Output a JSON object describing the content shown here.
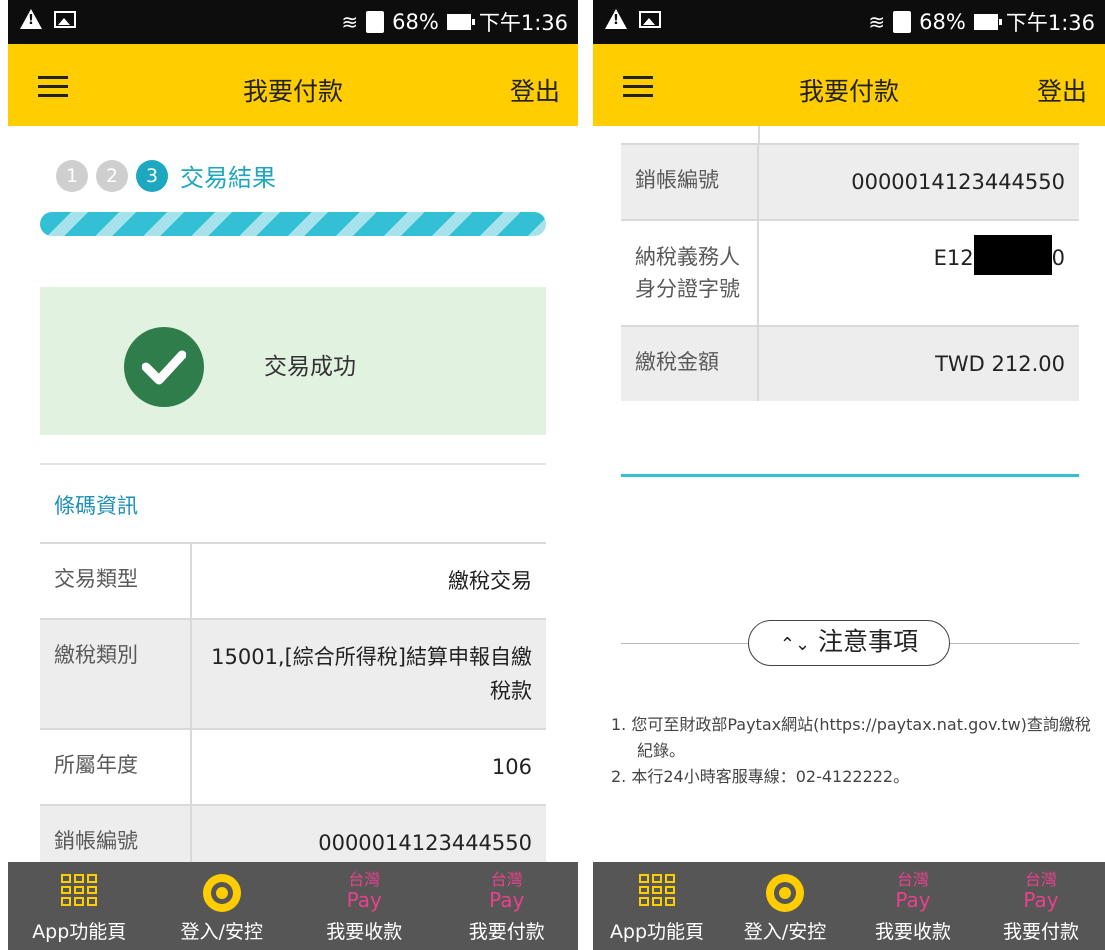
{
  "status_bar": {
    "battery": "68%",
    "time": "下午1:36"
  },
  "header": {
    "title": "我要付款",
    "logout": "登出"
  },
  "steps": {
    "items": [
      "1",
      "2",
      "3"
    ],
    "current_label": "交易結果"
  },
  "result": {
    "message": "交易成功"
  },
  "section": {
    "title": "條碼資訊"
  },
  "left_rows": [
    {
      "key": "交易類型",
      "value": "繳稅交易"
    },
    {
      "key": "繳稅類別",
      "value": "15001,[綜合所得稅]結算申報自繳稅款"
    },
    {
      "key": "所屬年度",
      "value": "106"
    },
    {
      "key": "銷帳編號",
      "value": "0000014123444550"
    }
  ],
  "right_rows": [
    {
      "key": "銷帳編號",
      "value": "0000014123444550"
    },
    {
      "key": "納稅義務人身分證字號",
      "value_prefix": "E12",
      "value_suffix": "0"
    },
    {
      "key": "繳稅金額",
      "value": "TWD 212.00"
    }
  ],
  "notice": {
    "title": "注意事項",
    "items": [
      "1. 您可至財政部Paytax網站(https://paytax.nat.gov.tw)查詢繳稅紀錄。",
      "2. 本行24小時客服專線：02-4122222。"
    ]
  },
  "bottom_nav": {
    "pay_icon_top": "台灣",
    "pay_icon_bottom": "Pay",
    "items": [
      "App功能頁",
      "登入/安控",
      "我要收款",
      "我要付款"
    ]
  },
  "colors": {
    "header": "#ffcd00",
    "accent": "#1ea8bf",
    "success_bg": "#e1f2e0",
    "nav_bg": "#565656",
    "pay_pink": "#e8428c"
  },
  "icons": [
    "warning-icon",
    "image-icon",
    "wifi-icon",
    "sd-card-icon",
    "battery-icon",
    "menu-icon",
    "check-circle-icon",
    "grid-icon",
    "gear-icon",
    "taiwan-pay-icon",
    "chevron-updown-icon"
  ]
}
